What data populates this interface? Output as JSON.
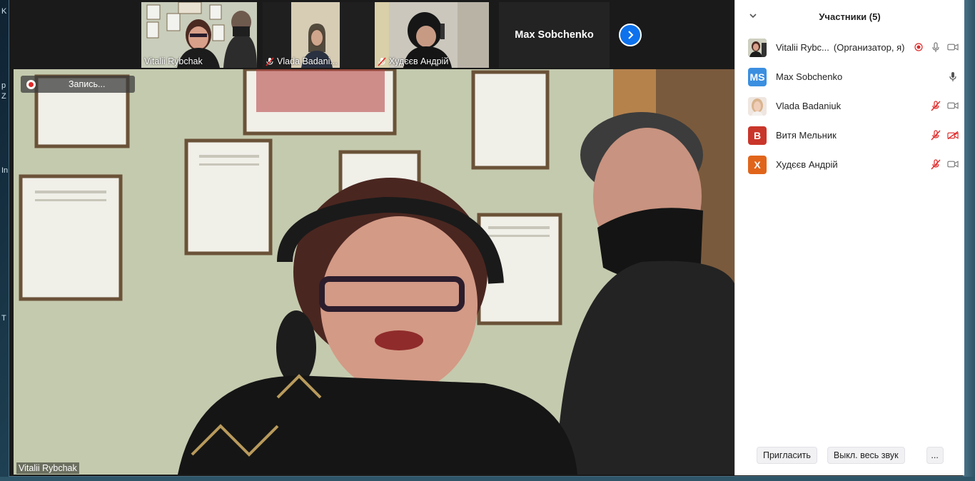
{
  "desktop": {
    "left_glyphs": [
      "K",
      "р",
      "Z",
      "In",
      "T"
    ]
  },
  "thumbnails": [
    {
      "name": "Vitalii Rybchak",
      "muted": false,
      "active": true
    },
    {
      "name": "Vlada Badani...",
      "muted": true,
      "active": false
    },
    {
      "name": "Худєєв Андрій",
      "muted": true,
      "active": false
    }
  ],
  "name_tile": {
    "name": "Max Sobchenko"
  },
  "next_button": {
    "icon": "chevron-right-icon"
  },
  "recording": {
    "label": "Запись..."
  },
  "main_video": {
    "speaker_name": "Vitalii Rybchak"
  },
  "panel": {
    "title": "Участники (5)",
    "participants": [
      {
        "name": "Vitalii Rybc...",
        "role": "(Организатор, я)",
        "avatar": "photo",
        "recording": true,
        "mic": "on",
        "video": "on"
      },
      {
        "name": "Max Sobchenko",
        "role": "",
        "avatar": "MS",
        "avatar_color": "#3b8fe0",
        "mic": "on",
        "video": "none"
      },
      {
        "name": "Vlada Badaniuk",
        "role": "",
        "avatar": "photo",
        "mic": "muted",
        "video": "on"
      },
      {
        "name": "Витя Мельник",
        "role": "",
        "avatar": "В",
        "avatar_color": "#c9362a",
        "mic": "muted",
        "video": "off"
      },
      {
        "name": "Худєєв Андрій",
        "role": "",
        "avatar": "Х",
        "avatar_color": "#e0651b",
        "mic": "muted",
        "video": "on"
      }
    ],
    "footer": {
      "invite": "Пригласить",
      "mute_all": "Выкл. весь звук",
      "more": "..."
    }
  },
  "colors": {
    "accent": "#0e72ed",
    "active_outline": "#9bd13c",
    "muted_red": "#e02828"
  }
}
